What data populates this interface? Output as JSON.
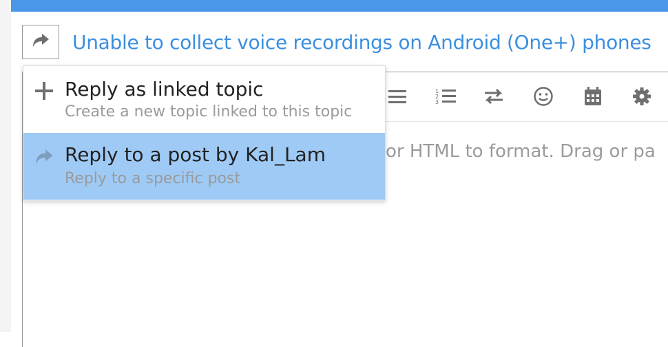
{
  "composer": {
    "title": "Unable to collect voice recordings on Android (One+) phones",
    "placeholder_visible": "or HTML to format. Drag or pa",
    "toggle_icon": "reply-arrow-icon"
  },
  "toolbar": {
    "items": [
      {
        "name": "bullet-list-icon"
      },
      {
        "name": "numbered-list-icon"
      },
      {
        "name": "rtl-toggle-icon"
      },
      {
        "name": "emoji-icon"
      },
      {
        "name": "calendar-icon"
      },
      {
        "name": "gear-icon"
      }
    ]
  },
  "reply_menu": {
    "items": [
      {
        "label": "Reply as linked topic",
        "description": "Create a new topic linked to this topic",
        "icon": "plus-icon",
        "selected": false
      },
      {
        "label": "Reply to a post by Kal_Lam",
        "description": "Reply to a specific post",
        "icon": "reply-arrow-icon",
        "selected": true
      }
    ]
  },
  "colors": {
    "accent": "#4a96e8",
    "title": "#3b8fe0",
    "selected_bg": "#9fcaf5"
  }
}
